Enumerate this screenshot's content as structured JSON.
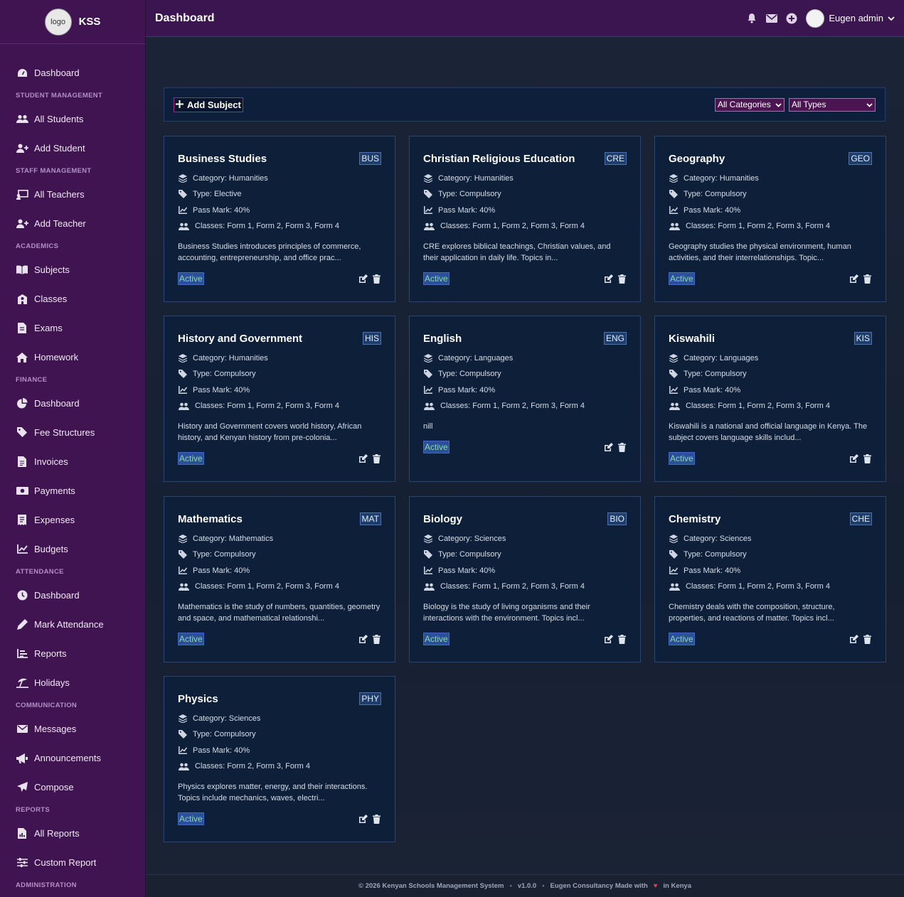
{
  "brand": {
    "logo_text": "logo",
    "name": "KSS"
  },
  "header": {
    "title": "Dashboard",
    "user_name": "Eugen admin"
  },
  "sidebar": {
    "items": [
      {
        "type": "item",
        "label": "Dashboard",
        "icon": "gauge-icon"
      },
      {
        "type": "section",
        "label": "STUDENT MANAGEMENT"
      },
      {
        "type": "item",
        "label": "All Students",
        "icon": "users-icon"
      },
      {
        "type": "item",
        "label": "Add Student",
        "icon": "user-plus-icon"
      },
      {
        "type": "section",
        "label": "STAFF MANAGEMENT"
      },
      {
        "type": "item",
        "label": "All Teachers",
        "icon": "chalkboard-icon"
      },
      {
        "type": "item",
        "label": "Add Teacher",
        "icon": "user-plus-icon"
      },
      {
        "type": "section",
        "label": "ACADEMICS"
      },
      {
        "type": "item",
        "label": "Subjects",
        "icon": "book-icon"
      },
      {
        "type": "item",
        "label": "Classes",
        "icon": "school-icon"
      },
      {
        "type": "item",
        "label": "Exams",
        "icon": "file-icon"
      },
      {
        "type": "item",
        "label": "Homework",
        "icon": "home-icon"
      },
      {
        "type": "section",
        "label": "FINANCE"
      },
      {
        "type": "item",
        "label": "Dashboard",
        "icon": "pie-chart-icon"
      },
      {
        "type": "item",
        "label": "Fee Structures",
        "icon": "tags-icon"
      },
      {
        "type": "item",
        "label": "Invoices",
        "icon": "file-invoice-icon"
      },
      {
        "type": "item",
        "label": "Payments",
        "icon": "money-icon"
      },
      {
        "type": "item",
        "label": "Expenses",
        "icon": "receipt-icon"
      },
      {
        "type": "item",
        "label": "Budgets",
        "icon": "line-chart-icon"
      },
      {
        "type": "section",
        "label": "ATTENDANCE"
      },
      {
        "type": "item",
        "label": "Dashboard",
        "icon": "clock-icon"
      },
      {
        "type": "item",
        "label": "Mark Attendance",
        "icon": "pen-icon"
      },
      {
        "type": "item",
        "label": "Reports",
        "icon": "bar-list-icon"
      },
      {
        "type": "item",
        "label": "Holidays",
        "icon": "umbrella-beach-icon"
      },
      {
        "type": "section",
        "label": "COMMUNICATION"
      },
      {
        "type": "item",
        "label": "Messages",
        "icon": "envelope-icon"
      },
      {
        "type": "item",
        "label": "Announcements",
        "icon": "bullhorn-icon"
      },
      {
        "type": "item",
        "label": "Compose",
        "icon": "paper-plane-icon"
      },
      {
        "type": "section",
        "label": "REPORTS"
      },
      {
        "type": "item",
        "label": "All Reports",
        "icon": "file-chart-icon"
      },
      {
        "type": "item",
        "label": "Custom Report",
        "icon": "sliders-icon"
      },
      {
        "type": "section",
        "label": "ADMINISTRATION"
      }
    ]
  },
  "toolbar": {
    "add_label": "Add Subject",
    "category_filter": "All Categories",
    "type_filter": "All Types"
  },
  "labels": {
    "category": "Category:",
    "type": "Type:",
    "pass_mark": "Pass Mark:",
    "classes": "Classes:"
  },
  "subjects": [
    {
      "name": "Business Studies",
      "code": "BUS",
      "category": "Humanities",
      "type": "Elective",
      "pass_mark": "40%",
      "classes": "Form 1, Form 2, Form 3, Form 4",
      "description": "Business Studies introduces principles of commerce, accounting, entrepreneurship, and office prac...",
      "status": "Active"
    },
    {
      "name": "Christian Religious Education",
      "code": "CRE",
      "category": "Humanities",
      "type": "Compulsory",
      "pass_mark": "40%",
      "classes": "Form 1, Form 2, Form 3, Form 4",
      "description": "CRE explores biblical teachings, Christian values, and their application in daily life. Topics in...",
      "status": "Active"
    },
    {
      "name": "Geography",
      "code": "GEO",
      "category": "Humanities",
      "type": "Compulsory",
      "pass_mark": "40%",
      "classes": "Form 1, Form 2, Form 3, Form 4",
      "description": "Geography studies the physical environment, human activities, and their interrelationships. Topic...",
      "status": "Active"
    },
    {
      "name": "History and Government",
      "code": "HIS",
      "category": "Humanities",
      "type": "Compulsory",
      "pass_mark": "40%",
      "classes": "Form 1, Form 2, Form 3, Form 4",
      "description": "History and Government covers world history, African history, and Kenyan history from pre-colonia...",
      "status": "Active"
    },
    {
      "name": "English",
      "code": "ENG",
      "category": "Languages",
      "type": "Compulsory",
      "pass_mark": "40%",
      "classes": "Form 1, Form 2, Form 3, Form 4",
      "description": "nill",
      "status": "Active"
    },
    {
      "name": "Kiswahili",
      "code": "KIS",
      "category": "Languages",
      "type": "Compulsory",
      "pass_mark": "40%",
      "classes": "Form 1, Form 2, Form 3, Form 4",
      "description": "Kiswahili is a national and official language in Kenya. The subject covers language skills includ...",
      "status": "Active"
    },
    {
      "name": "Mathematics",
      "code": "MAT",
      "category": "Mathematics",
      "type": "Compulsory",
      "pass_mark": "40%",
      "classes": "Form 1, Form 2, Form 3, Form 4",
      "description": "Mathematics is the study of numbers, quantities, geometry and space, and mathematical relationshi...",
      "status": "Active"
    },
    {
      "name": "Biology",
      "code": "BIO",
      "category": "Sciences",
      "type": "Compulsory",
      "pass_mark": "40%",
      "classes": "Form 1, Form 2, Form 3, Form 4",
      "description": "Biology is the study of living organisms and their interactions with the environment. Topics incl...",
      "status": "Active"
    },
    {
      "name": "Chemistry",
      "code": "CHE",
      "category": "Sciences",
      "type": "Compulsory",
      "pass_mark": "40%",
      "classes": "Form 1, Form 2, Form 3, Form 4",
      "description": "Chemistry deals with the composition, structure, properties, and reactions of matter. Topics incl...",
      "status": "Active"
    },
    {
      "name": "Physics",
      "code": "PHY",
      "category": "Sciences",
      "type": "Compulsory",
      "pass_mark": "40%",
      "classes": "Form 2, Form 3, Form 4",
      "description": "Physics explores matter, energy, and their interactions. Topics include mechanics, waves, electri...",
      "status": "Active"
    }
  ],
  "footer": {
    "copyright": "© 2026 Kenyan Schools Management System",
    "version": "v1.0.0",
    "credit_prefix": "Eugen Consultancy Made with",
    "credit_suffix": "in Kenya"
  },
  "colors": {
    "sidebar_bg": "#3f1451",
    "topbar_bg": "#3b1550",
    "card_bg": "#0e2039",
    "status_bg": "#2b4f9a",
    "status_text": "#8ad9a4"
  }
}
